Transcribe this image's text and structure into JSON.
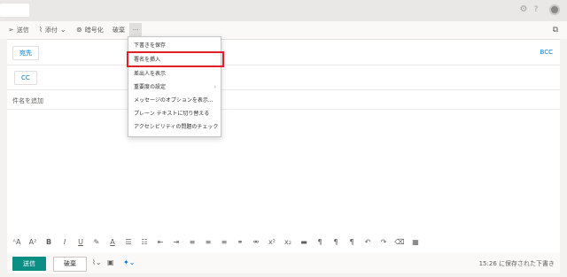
{
  "toolbar": {
    "send": "送信",
    "attach": "添付",
    "encrypt": "暗号化",
    "discard": "破棄",
    "more": "···"
  },
  "compose": {
    "to_label": "宛先",
    "cc_label": "CC",
    "bcc_label": "BCC",
    "subject_placeholder": "件名を追加"
  },
  "menu": {
    "items": [
      {
        "label": "下書きを保存"
      },
      {
        "label": "署名を挿入"
      },
      {
        "label": "差出人を表示"
      },
      {
        "label": "重要度の設定"
      },
      {
        "label": "メッセージのオプションを表示..."
      },
      {
        "label": "プレーン テキストに切り替える"
      },
      {
        "label": "アクセシビリティの問題のチェック"
      }
    ],
    "highlighted_item": "署名を挿入"
  },
  "footer": {
    "send": "送信",
    "discard": "破棄",
    "saved_status": "15:26 に保存された下書き"
  },
  "icons": {
    "format_bar": [
      "font-size-icon",
      "superscript-a-icon",
      "bold-icon",
      "italic-icon",
      "underline-icon",
      "highlight-icon",
      "font-color-icon",
      "bullets-icon",
      "numbering-icon",
      "outdent-icon",
      "indent-icon",
      "align-left-icon",
      "align-center-icon",
      "align-right-icon",
      "link-icon",
      "unlink-icon",
      "superscript-icon",
      "subscript-icon",
      "strikethrough-icon",
      "ltr-icon",
      "rtl-icon",
      "paragraph-icon",
      "undo-icon",
      "redo-icon",
      "clear-format-icon",
      "table-icon"
    ]
  },
  "colors": {
    "accent": "#0b8f84",
    "link": "#0078d4",
    "highlight_border": "#e21f26"
  }
}
